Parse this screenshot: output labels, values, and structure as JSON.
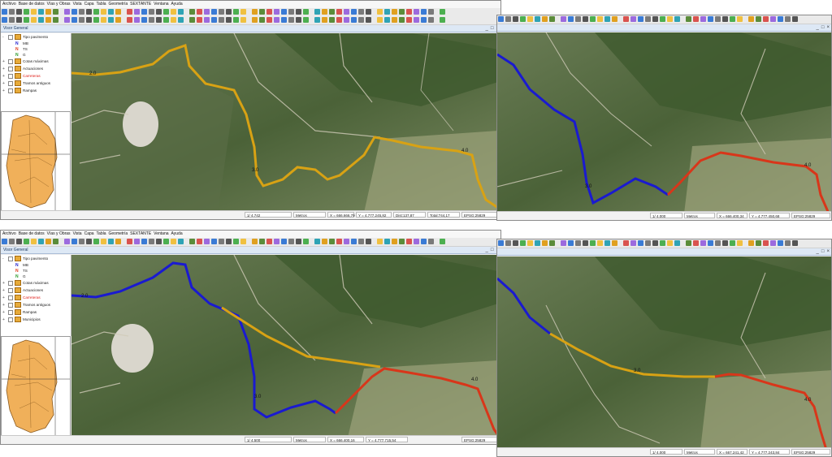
{
  "menu": [
    "Archivo",
    "Base de datos",
    "Vías y Obras",
    "Vista",
    "Capa",
    "Tabla",
    "Geometría",
    "SEXTANTE",
    "Ventana",
    "Ayuda"
  ],
  "view_title": "Visor General",
  "window_buttons": [
    "_",
    "□",
    "×"
  ],
  "legend": {
    "group_label": "Tipo pavimento",
    "classes": [
      {
        "code": "MB",
        "color": "#1a1ad0"
      },
      {
        "code": "TS",
        "color": "#e03a1a"
      },
      {
        "code": "G",
        "color": "#2a9a2a"
      }
    ],
    "layers": [
      "Cotas máximas",
      "Actuaciones",
      "Carreteras",
      "Tramos antiguos",
      "Rampas"
    ],
    "layers_bottom": [
      "Cotas máximas",
      "Actuaciones",
      "Carreteras",
      "Tramos antiguos",
      "Rampas",
      "Municipios"
    ]
  },
  "panels": [
    {
      "scale": "1/ 4.742",
      "units": "Metros",
      "x": "X = 666.666,79",
      "y": "Y = 4.777.245,82",
      "dist": "Dist:137,87",
      "total": "Total:744,17",
      "epsg": "EPSG:25829",
      "label": "2.0",
      "label2": "3.0",
      "label3": "4.0"
    },
    {
      "scale": "1/ 4.000",
      "units": "Metros",
      "x": "X = 666.400,34",
      "y": "Y = 4.777.450,68",
      "epsg": "EPSG:25829",
      "label": "3.0",
      "label2": "4.0"
    },
    {
      "scale": "1/ 4.500",
      "units": "Metros",
      "x": "X = 666.400,16",
      "y": "Y = 4.777.715,54",
      "epsg": "EPSG:25829",
      "label": "2.0",
      "label2": "3.0",
      "label3": "4.0"
    },
    {
      "scale": "1/ 4.000",
      "units": "Metros",
      "x": "X = 667.241,42",
      "y": "Y = 4.777.243,84",
      "epsg": "EPSG:25829",
      "label": "3.0",
      "label2": "4.0"
    }
  ],
  "colors": {
    "asphalt": "#d8a214",
    "mb": "#1a1ad0",
    "ts": "#d8361a",
    "selected_layer": "#e0201b"
  }
}
